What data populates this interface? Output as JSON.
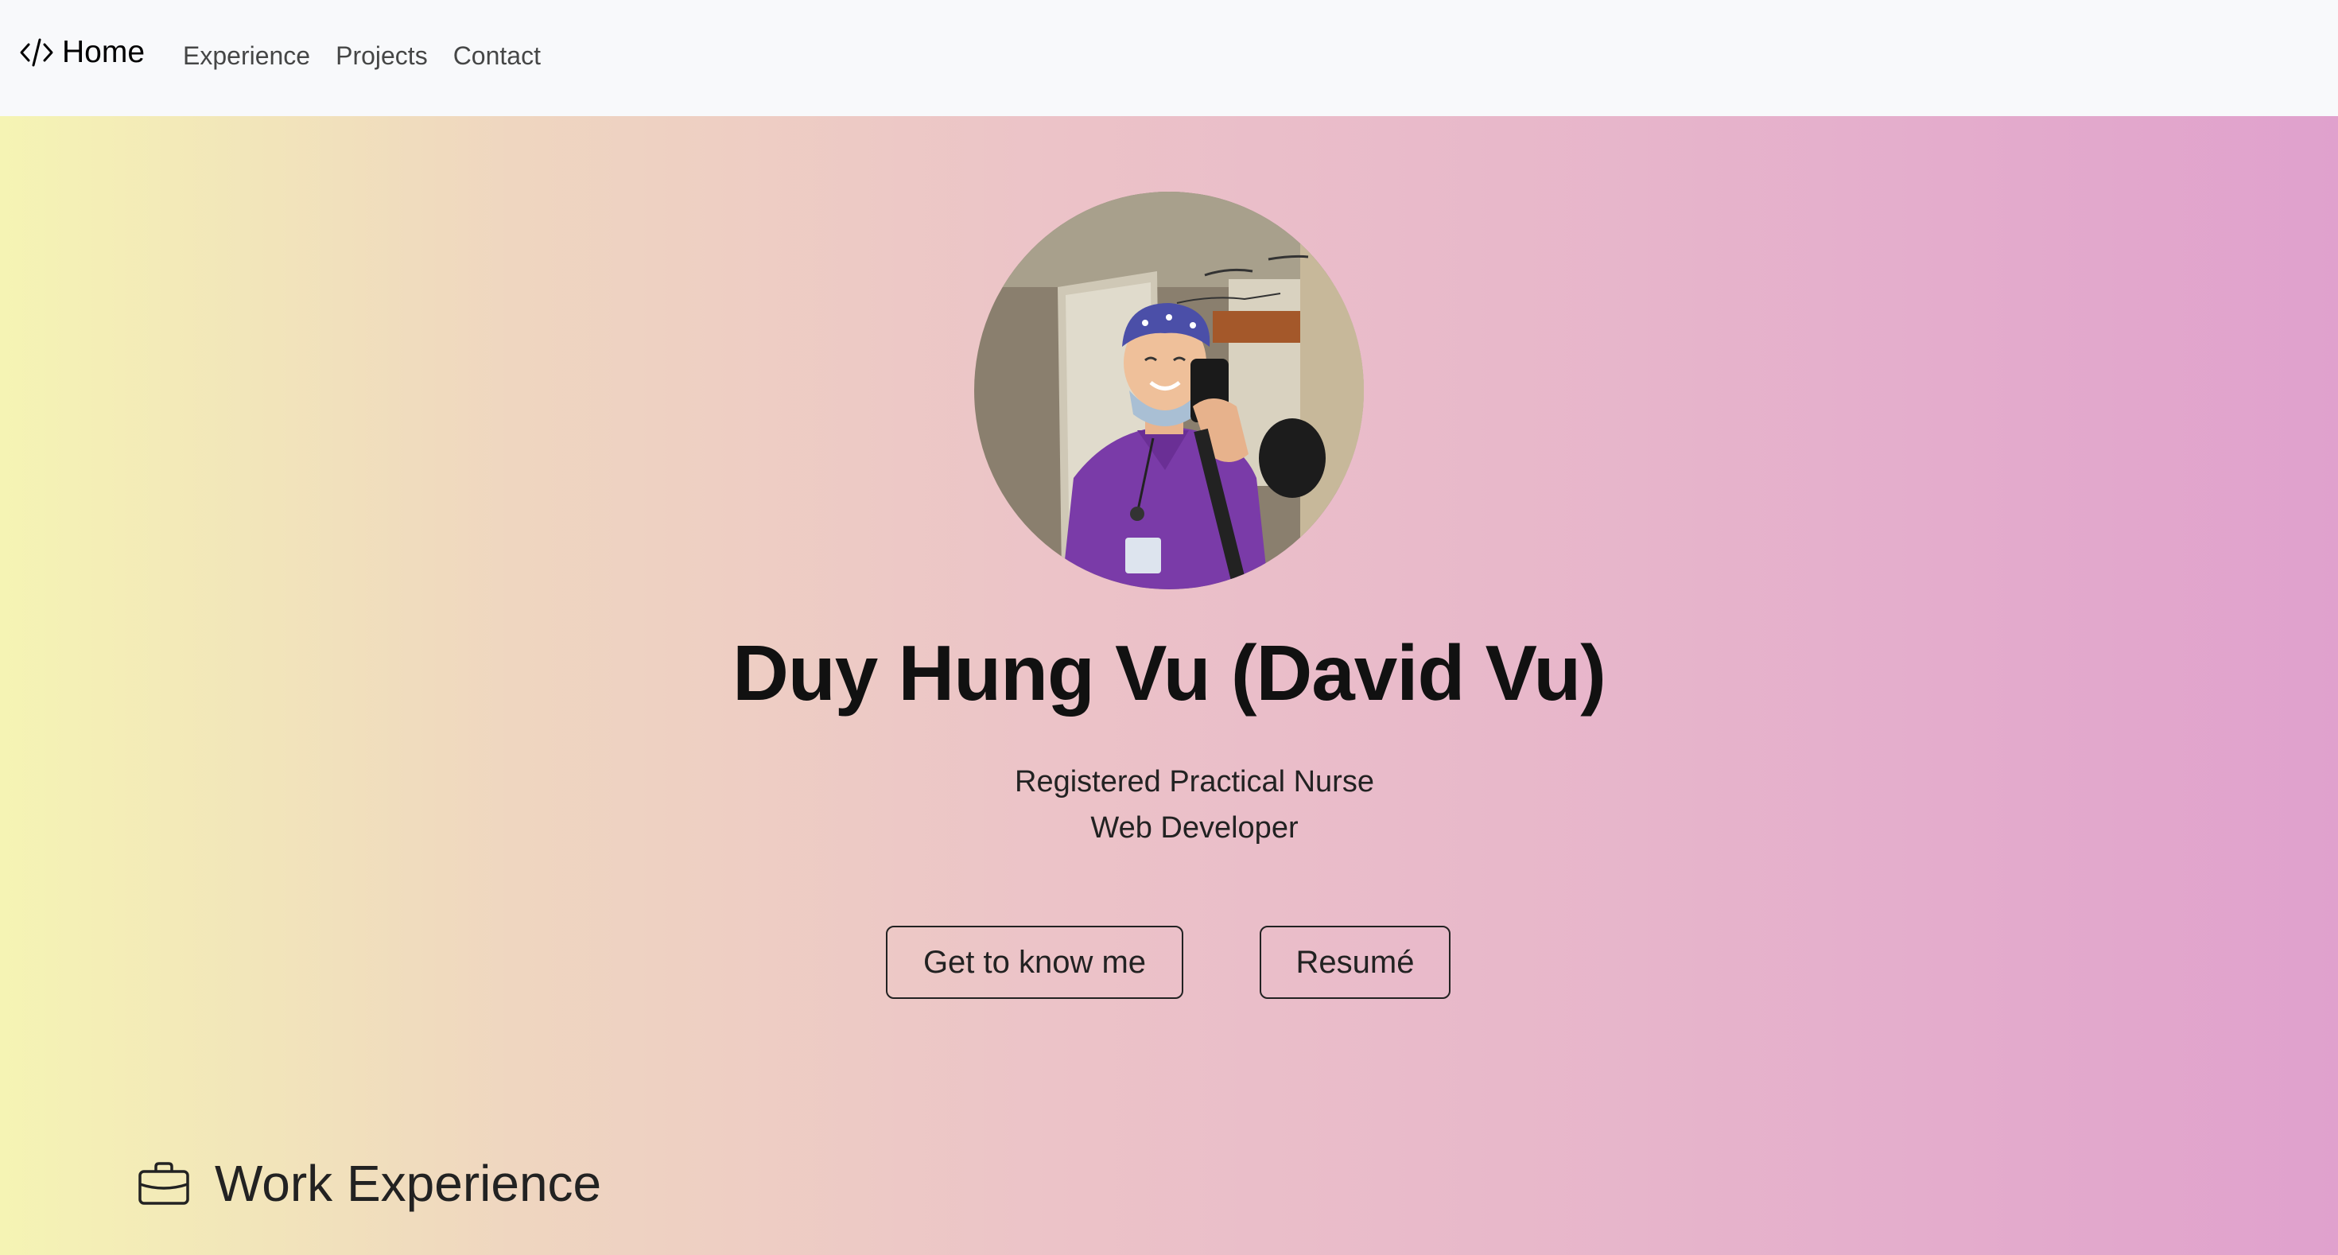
{
  "navbar": {
    "brand": {
      "icon": "code-icon",
      "label": "Home"
    },
    "links": [
      {
        "label": "Experience"
      },
      {
        "label": "Projects"
      },
      {
        "label": "Contact"
      }
    ]
  },
  "hero": {
    "avatar": "profile-photo",
    "name": "Duy Hung Vu (David Vu)",
    "roles": [
      "Registered Practical Nurse",
      "Web Developer"
    ],
    "buttons": {
      "primary_label": "Get to know me",
      "secondary_label": "Resumé"
    }
  },
  "work": {
    "icon": "briefcase-icon",
    "title": "Work Experience"
  },
  "colors": {
    "gradient_start": "#f5f4b4",
    "gradient_mid": "#ecc3c8",
    "gradient_end": "#e0a1cd",
    "navbar_bg": "#f8f9fb",
    "text_dark": "#111111"
  }
}
